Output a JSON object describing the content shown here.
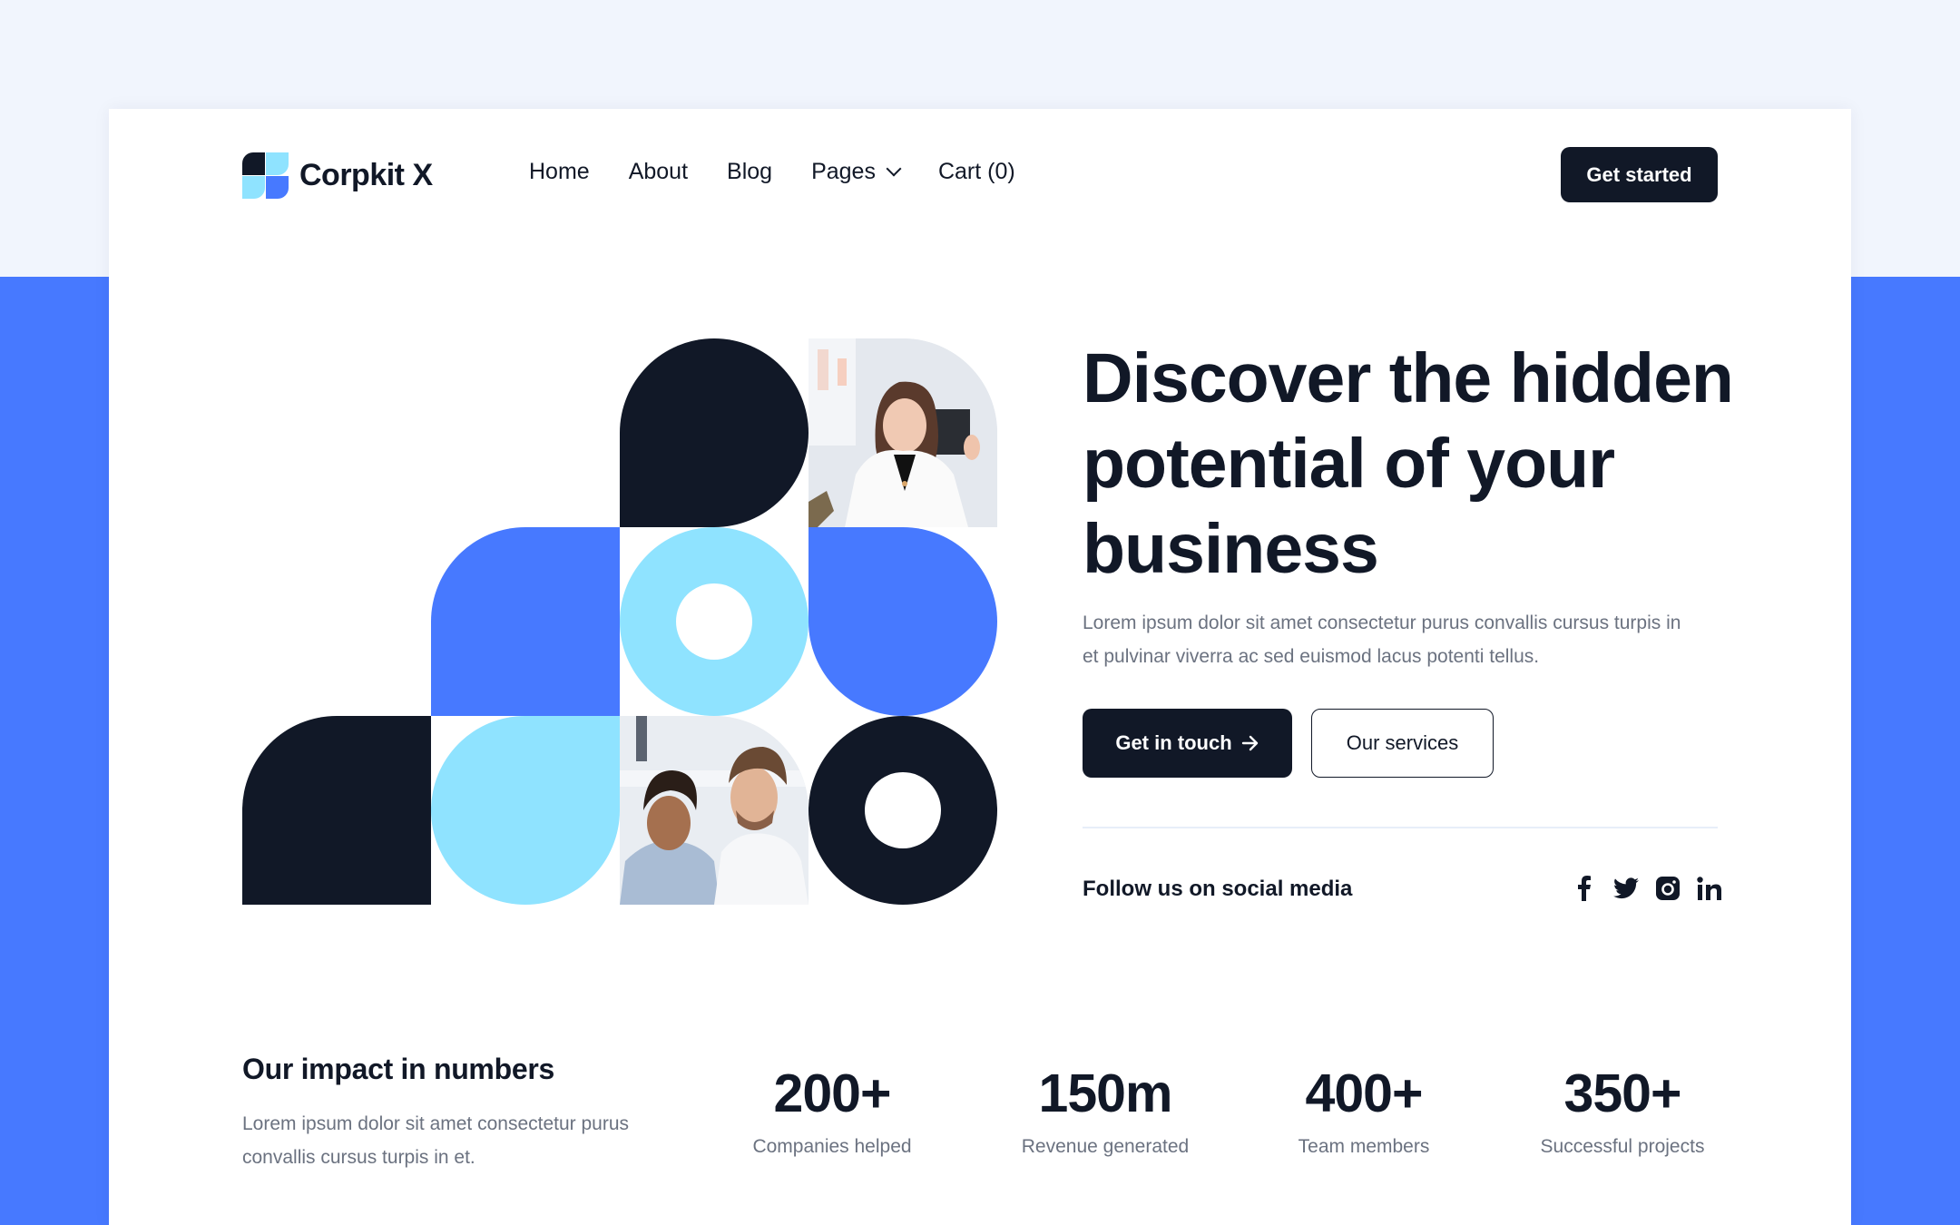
{
  "brand": {
    "name": "Corpkit X"
  },
  "nav": {
    "items": [
      {
        "label": "Home"
      },
      {
        "label": "About"
      },
      {
        "label": "Blog"
      },
      {
        "label": "Pages",
        "has_dropdown": true
      },
      {
        "label": "Cart (0)"
      }
    ],
    "cta_label": "Get started"
  },
  "hero": {
    "title": "Discover the hidden potential of your business",
    "subtitle": "Lorem ipsum dolor sit amet consectetur purus convallis cursus turpis in et pulvinar viverra ac sed euismod lacus potenti tellus.",
    "primary_button": "Get in touch",
    "primary_button_icon": "arrow-right-icon",
    "secondary_button": "Our services",
    "social_label": "Follow us on social media",
    "socials": [
      {
        "name": "facebook-icon"
      },
      {
        "name": "twitter-icon"
      },
      {
        "name": "instagram-icon"
      },
      {
        "name": "linkedin-icon"
      }
    ]
  },
  "impact": {
    "title": "Our impact in numbers",
    "subtitle": "Lorem ipsum dolor sit amet consectetur purus convallis cursus turpis in et.",
    "stats": [
      {
        "value": "200+",
        "label": "Companies helped"
      },
      {
        "value": "150m",
        "label": "Revenue generated"
      },
      {
        "value": "400+",
        "label": "Team members"
      },
      {
        "value": "350+",
        "label": "Successful projects"
      }
    ]
  },
  "colors": {
    "dark": "#111827",
    "blue": "#4779FF",
    "cyan": "#8FE3FF",
    "page_bg": "#F1F5FD",
    "muted_text": "#6B7280"
  }
}
